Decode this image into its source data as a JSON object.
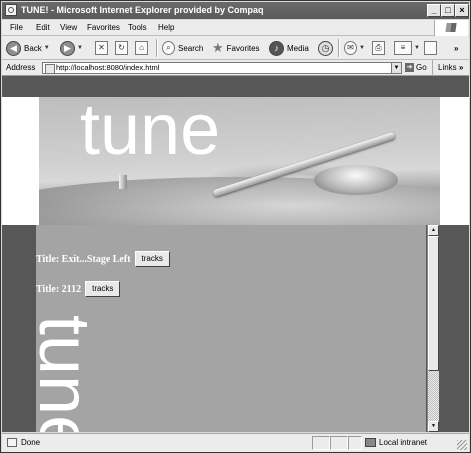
{
  "window": {
    "title": "TUNE! - Microsoft Internet Explorer provided by Compaq",
    "controls": {
      "minimize": "_",
      "maximize": "□",
      "close": "×"
    }
  },
  "menu": [
    "File",
    "Edit",
    "View",
    "Favorites",
    "Tools",
    "Help"
  ],
  "toolbar": {
    "back": "Back",
    "search": "Search",
    "favorites": "Favorites",
    "media": "Media",
    "more": "»"
  },
  "address": {
    "label": "Address",
    "url": "http://localhost:8080/index.html",
    "go": "Go",
    "links": "Links",
    "links_more": "»"
  },
  "banner": {
    "word": "tune"
  },
  "songs": [
    {
      "title": "Title: Exit...Stage Left",
      "button": "tracks"
    },
    {
      "title": "Title: 2112",
      "button": "tracks"
    }
  ],
  "side_word": "tune",
  "status": {
    "text": "Done",
    "zone": "Local intranet"
  }
}
